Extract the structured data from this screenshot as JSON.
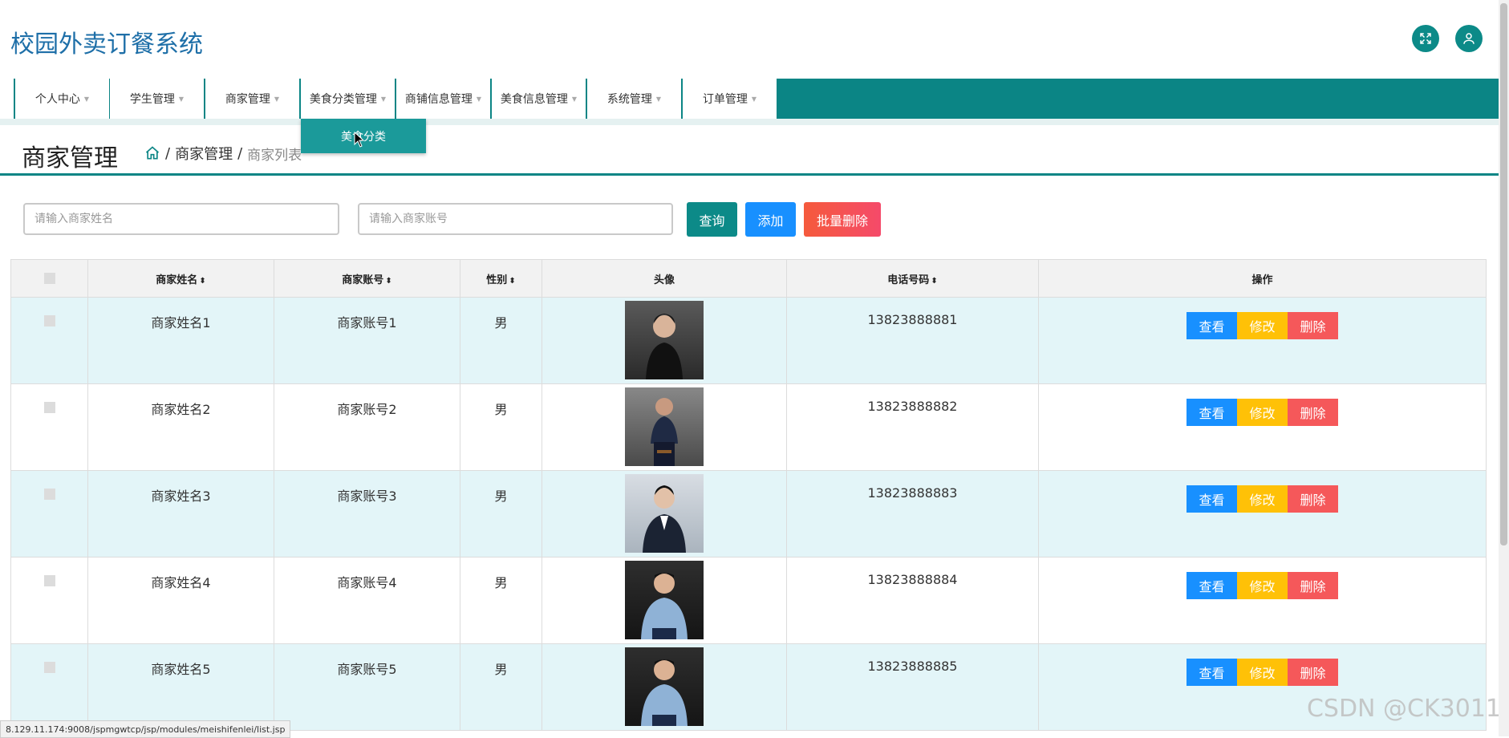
{
  "header": {
    "title": "校园外卖订餐系统",
    "icons": [
      "fullscreen-icon",
      "user-icon"
    ]
  },
  "nav": {
    "items": [
      {
        "label": "个人中心"
      },
      {
        "label": "学生管理"
      },
      {
        "label": "商家管理"
      },
      {
        "label": "美食分类管理"
      },
      {
        "label": "商铺信息管理"
      },
      {
        "label": "美食信息管理"
      },
      {
        "label": "系统管理"
      },
      {
        "label": "订单管理"
      }
    ],
    "dropdown_item": "美食分类"
  },
  "page": {
    "title": "商家管理",
    "breadcrumb": {
      "sep": "/",
      "parent": "商家管理",
      "current": "商家列表"
    }
  },
  "search": {
    "name_placeholder": "请输入商家姓名",
    "account_placeholder": "请输入商家账号",
    "query_label": "查询",
    "add_label": "添加",
    "batch_delete_label": "批量删除"
  },
  "table": {
    "headers": {
      "name": "商家姓名",
      "account": "商家账号",
      "gender": "性别",
      "avatar": "头像",
      "phone": "电话号码",
      "actions": "操作"
    },
    "sort_glyph": "⬍",
    "rows": [
      {
        "name": "商家姓名1",
        "account": "商家账号1",
        "gender": "男",
        "phone": "13823888881"
      },
      {
        "name": "商家姓名2",
        "account": "商家账号2",
        "gender": "男",
        "phone": "13823888882"
      },
      {
        "name": "商家姓名3",
        "account": "商家账号3",
        "gender": "男",
        "phone": "13823888883"
      },
      {
        "name": "商家姓名4",
        "account": "商家账号4",
        "gender": "男",
        "phone": "13823888884"
      },
      {
        "name": "商家姓名5",
        "account": "商家账号5",
        "gender": "男",
        "phone": "13823888885"
      }
    ],
    "actions": {
      "view": "查看",
      "edit": "修改",
      "delete": "删除"
    }
  },
  "statusbar": {
    "url": "8.129.11.174:9008/jspmgwtcp/jsp/modules/meishifenlei/list.jsp"
  },
  "watermark": "CSDN @CK3011",
  "colors": {
    "nav_teal": "#0b8585",
    "title_blue": "#1e6fa8",
    "query_btn": "#0c8a88",
    "add_btn": "#1890ff",
    "batch_delete_btn": "#f0504c",
    "view_btn": "#1890ff",
    "edit_btn": "#ffc107",
    "delete_btn": "#f5585a",
    "row_highlight": "#e3f5f8"
  }
}
